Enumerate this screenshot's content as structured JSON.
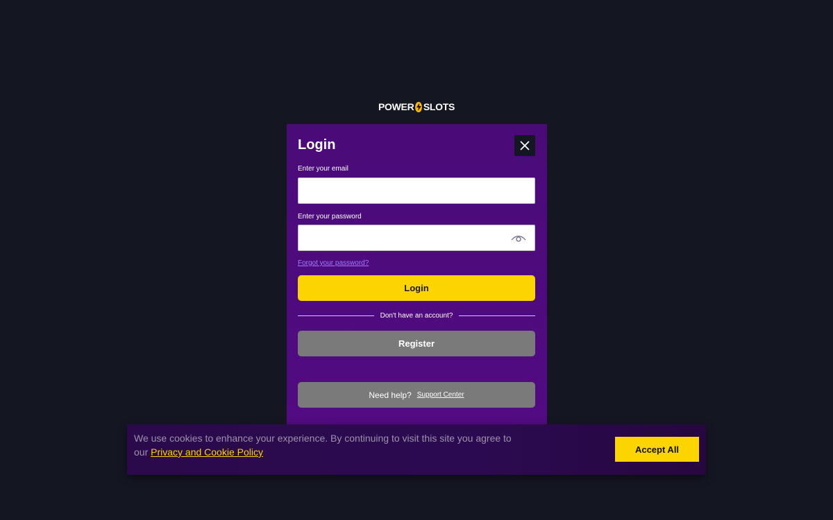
{
  "brand": {
    "name_left": "POWER",
    "name_right": "SLOTS"
  },
  "modal": {
    "title": "Login",
    "email_label": "Enter your email",
    "email_value": "",
    "password_label": "Enter your password",
    "password_value": "",
    "forgot_link": "Forgot your password?",
    "login_button": "Login",
    "divider_text": "Don't have an account?",
    "register_button": "Register",
    "help_text": "Need help?",
    "support_link": "Support Center"
  },
  "cookie": {
    "text_before": "We use cookies to enhance your experience. By continuing to visit this site you agree to our",
    "policy_link": "Privacy and Cookie Policy",
    "accept_button": "Accept All"
  },
  "colors": {
    "page_bg": "#141622",
    "modal_bg": "#4e0b7e",
    "accent_yellow": "#fcd400",
    "button_grey": "#7a7a7a",
    "link_purple": "#a27bff"
  },
  "icons": {
    "close": "close-icon",
    "eye": "eye-icon",
    "bolt": "lightning-bolt-icon"
  }
}
